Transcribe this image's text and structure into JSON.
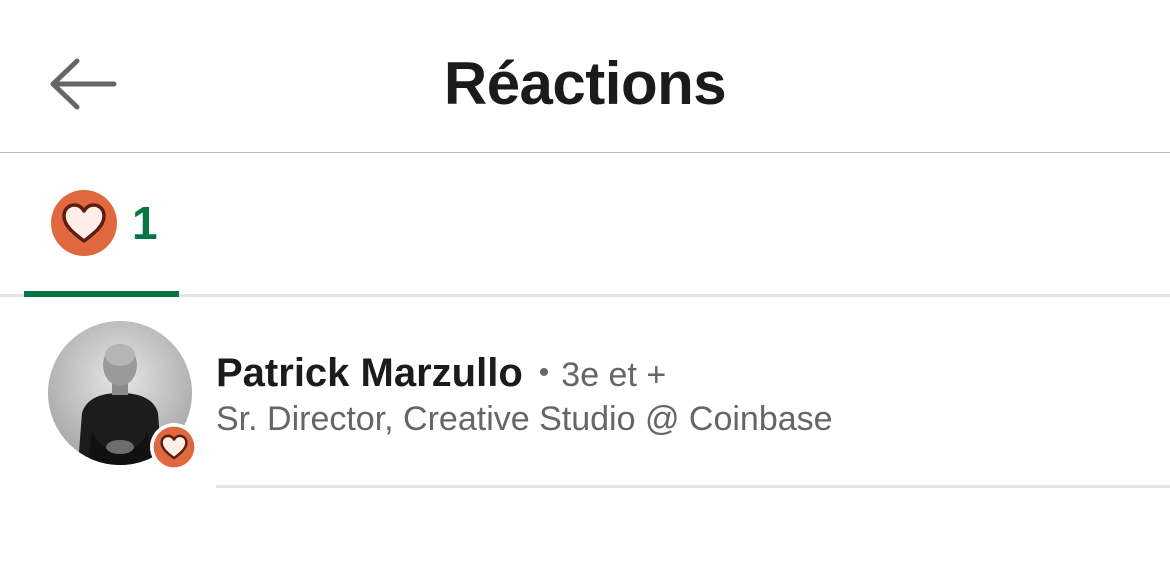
{
  "header": {
    "title": "Réactions",
    "back_icon": "arrow-left-icon"
  },
  "tabs": [
    {
      "reaction": "love",
      "icon": "heart-reaction-icon",
      "count": "1",
      "selected": true
    }
  ],
  "reactions": [
    {
      "name": "Patrick Marzullo",
      "separator": "•",
      "degree": "3e et +",
      "headline": "Sr. Director, Creative Studio @ Coinbase",
      "reaction_icon": "heart-reaction-icon"
    }
  ],
  "colors": {
    "accent_green": "#057642",
    "reaction_orange": "#e0683f",
    "heart_fill": "#fdeee8",
    "heart_stroke": "#5c1d0c"
  }
}
